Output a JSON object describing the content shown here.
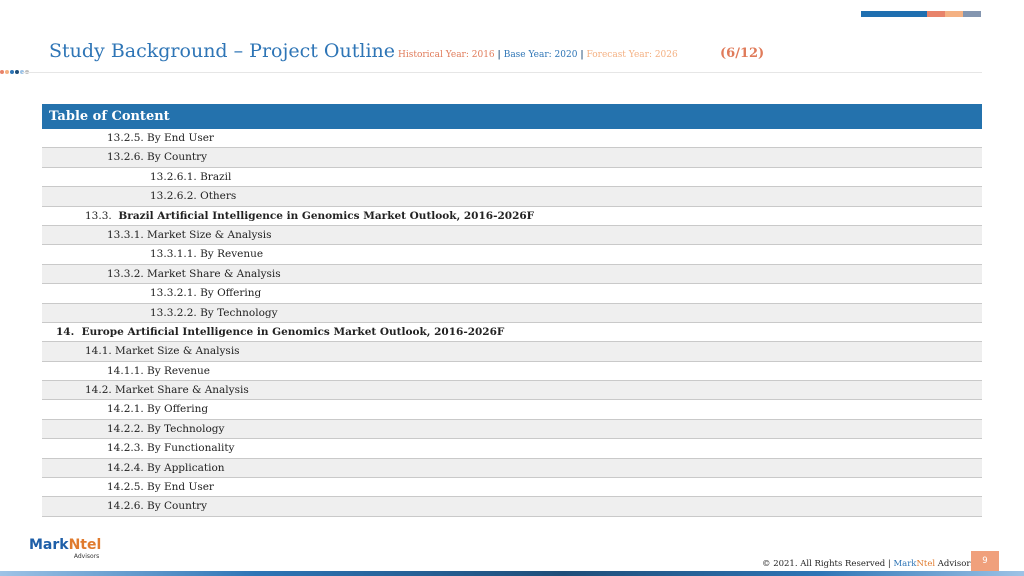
{
  "header": {
    "title": "Study Background – Project Outline",
    "historical": "Historical Year: 2016",
    "separator": "|",
    "base": "Base Year: 2020",
    "forecast": "Forecast Year: 2026",
    "page_count": "(6/12)"
  },
  "colors": {
    "primary_blue": "#2472ad",
    "accent_orange": "#e07b5a",
    "accent_peach": "#f4b183",
    "row_alt": "#efefef"
  },
  "toc": {
    "header": "Table of Content",
    "rows": [
      {
        "num": "13.2.5.",
        "text": "By End User"
      },
      {
        "num": "13.2.6.",
        "text": "By Country"
      },
      {
        "num": "",
        "text": "13.2.6.1. Brazil"
      },
      {
        "num": "",
        "text": "13.2.6.2. Others"
      },
      {
        "num": "13.3.",
        "text": "Brazil Artificial Intelligence in Genomics Market Outlook, 2016-2026F"
      },
      {
        "num": "13.3.1.",
        "text": "Market Size & Analysis"
      },
      {
        "num": "",
        "text": "13.3.1.1. By Revenue"
      },
      {
        "num": "13.3.2.",
        "text": "Market Share & Analysis"
      },
      {
        "num": "",
        "text": "13.3.2.1. By Offering"
      },
      {
        "num": "",
        "text": "13.3.2.2. By Technology"
      },
      {
        "num": "14.",
        "text": "Europe Artificial Intelligence in Genomics Market Outlook, 2016-2026F"
      },
      {
        "num": "",
        "text": "14.1. Market Size & Analysis"
      },
      {
        "num": "14.1.1.",
        "text": "By Revenue"
      },
      {
        "num": "",
        "text": "14.2. Market Share & Analysis"
      },
      {
        "num": "14.2.1.",
        "text": "By Offering"
      },
      {
        "num": "14.2.2.",
        "text": "By Technology"
      },
      {
        "num": "14.2.3.",
        "text": "By Functionality"
      },
      {
        "num": "14.2.4.",
        "text": "By Application"
      },
      {
        "num": "14.2.5.",
        "text": "By End User"
      },
      {
        "num": "14.2.6.",
        "text": "By Country"
      }
    ]
  },
  "logo": {
    "mark": "Mark",
    "ntel": "Ntel",
    "sub": "Advisors"
  },
  "footer": {
    "copyright": "© 2021. All Rights Reserved |",
    "brand_mark": "Mark",
    "brand_ntel": "Ntel",
    "brand_rest": "Advisors",
    "page_number": "9"
  }
}
